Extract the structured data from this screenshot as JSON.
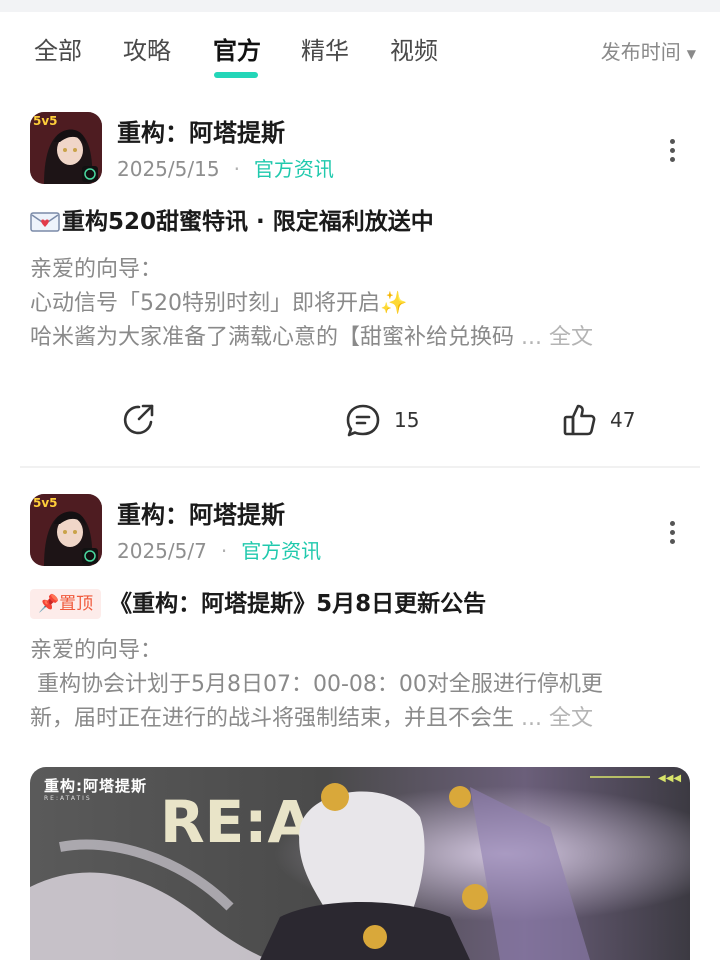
{
  "tabs": [
    {
      "label": "全部"
    },
    {
      "label": "攻略"
    },
    {
      "label": "官方",
      "active": true
    },
    {
      "label": "精华"
    },
    {
      "label": "视频"
    }
  ],
  "sort": {
    "label": "发布时间"
  },
  "posts": [
    {
      "author": "重构：阿塔提斯",
      "date": "2025/5/15",
      "category": "官方资讯",
      "title": "重构520甜蜜特讯 · 限定福利放送中",
      "lines": [
        "亲爱的向导：",
        "心动信号「520特别时刻」即将开启",
        "哈米酱为大家准备了满载心意的【甜蜜补给兑换码"
      ],
      "ellipsis": " ... ",
      "full_text": "全文",
      "comments": "15",
      "likes": "47"
    },
    {
      "author": "重构：阿塔提斯",
      "date": "2025/5/7",
      "category": "官方资讯",
      "pin_label": "置顶",
      "title": "《重构：阿塔提斯》5月8日更新公告",
      "lines": [
        "亲爱的向导：",
        " 重构协会计划于5月8日07：00-08：00对全服进行停机更",
        "新，届时正在进行的战斗将强制结束，并且不会生"
      ],
      "ellipsis": " ... ",
      "full_text": "全文",
      "banner_title": "重构:阿塔提斯",
      "banner_sub": "RE:ATATIS",
      "banner_text": "RE:A"
    }
  ],
  "colors": {
    "accent": "#23d6b8",
    "category": "#20c9ad",
    "pin_bg": "#fdecea",
    "pin_text": "#f05a3c"
  },
  "icons": [
    "share-icon",
    "comment-icon",
    "like-icon",
    "more-icon",
    "pin-icon",
    "envelope-icon",
    "sparkle-icon",
    "caret-down-icon"
  ]
}
